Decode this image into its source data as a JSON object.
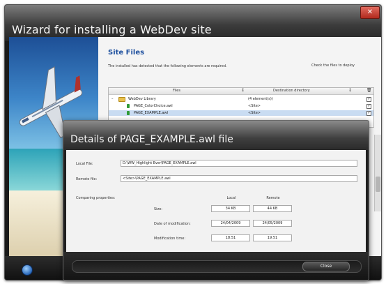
{
  "wizard": {
    "title": "Wizard for installing a WebDev site",
    "close_glyph": "✕"
  },
  "site_files": {
    "title": "Site Files",
    "description": "The installed has detected that the following elements are required.",
    "check_hint": "Check the files to deploy",
    "columns": [
      "Files",
      "Destination directory"
    ],
    "rows": [
      {
        "name": "WebDev Library",
        "destination": "(4 element(s))",
        "icon": "folder-icon",
        "checked": true,
        "selected": false
      },
      {
        "name": "PAGE_ColorChoice.awl",
        "destination": "<Site>",
        "icon": "file-icon",
        "checked": true,
        "selected": false
      },
      {
        "name": "PAGE_EXAMPLE.awl",
        "destination": "<Site>",
        "icon": "file-icon",
        "checked": true,
        "selected": true
      }
    ]
  },
  "details": {
    "title": "Details of PAGE_EXAMPLE.awl file",
    "local_file_label": "Local File:",
    "local_file_value": "D:\\WW_Highlight Ever\\PAGE_EXAMPLE.awl",
    "remote_file_label": "Remote file:",
    "remote_file_value": "<Site>\\PAGE_EXAMPLE.awl",
    "comparing_label": "Comparing properties:",
    "col_local": "Local",
    "col_remote": "Remote",
    "props": [
      {
        "label": "Size:",
        "local": "34 KB",
        "remote": "44 KB"
      },
      {
        "label": "Date of modification:",
        "local": "24/04/2009",
        "remote": "24/05/2009"
      },
      {
        "label": "Modification time:",
        "local": "18:51",
        "remote": "19:51"
      }
    ],
    "close_button": "Close"
  }
}
